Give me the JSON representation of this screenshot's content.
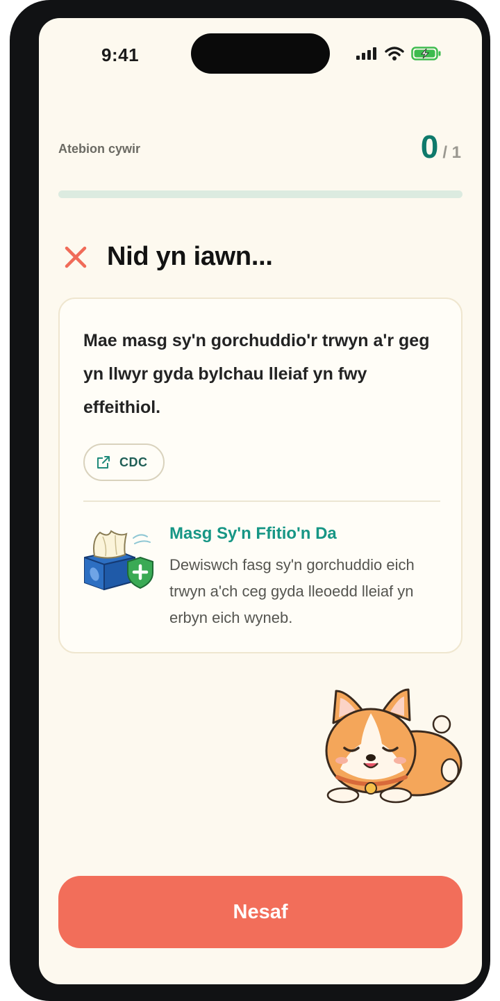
{
  "status_bar": {
    "time": "9:41"
  },
  "score": {
    "label": "Atebion cywir",
    "correct": "0",
    "total": "/ 1",
    "progress": 0
  },
  "result": {
    "title": "Nid yn iawn...",
    "icon": "close-icon",
    "icon_color": "#f06b58"
  },
  "card": {
    "statement": "Mae masg sy'n gorchuddio'r trwyn a'r geg yn llwyr gyda bylchau lleiaf yn fwy effeithiol.",
    "source": {
      "label": "CDC",
      "icon": "external-link-icon"
    },
    "tip": {
      "title": "Masg Sy'n Ffitio'n Da",
      "body": "Dewiswch fasg sy'n gorchuddio eich trwyn a'ch ceg gyda lleoedd lleiaf yn erbyn eich wyneb.",
      "illustration": "tissue-box-shield-icon"
    }
  },
  "mascot": "corgi-sleeping-icon",
  "next_button": {
    "label": "Nesaf"
  },
  "colors": {
    "accent": "#0f7a6b",
    "button": "#f26e5a",
    "background": "#fdf9ef",
    "tip_title": "#169685"
  }
}
